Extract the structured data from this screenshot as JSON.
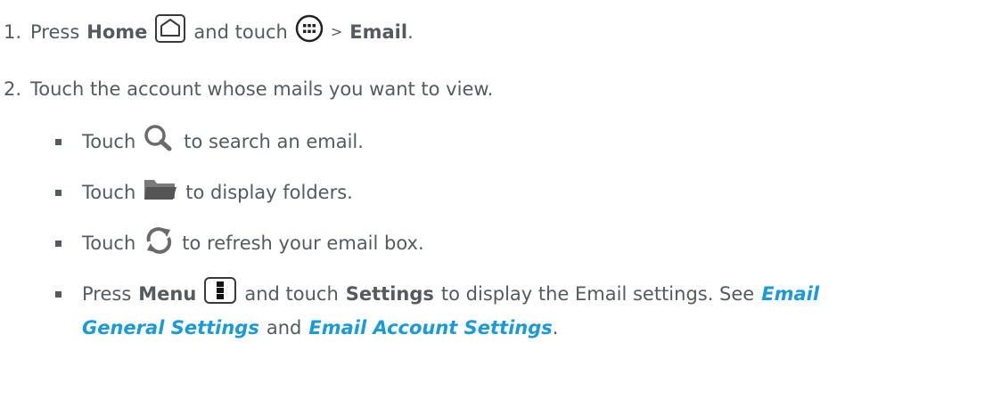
{
  "steps": [
    {
      "number": "1.",
      "text_a": "Press",
      "bold_a": "Home",
      "text_b": "and touch",
      "arrow": ">",
      "bold_b": "Email",
      "end": "."
    },
    {
      "number": "2.",
      "text": "Touch the account whose mails you want to view."
    }
  ],
  "bullets": {
    "search": {
      "text_a": "Touch",
      "text_b": "to search an email."
    },
    "folders": {
      "text_a": "Touch",
      "text_b": "to display folders."
    },
    "refresh": {
      "text_a": "Touch",
      "text_b": "to refresh your email box."
    },
    "menu": {
      "text_a": "Press",
      "bold_a": "Menu",
      "text_b": "and touch",
      "bold_b": "Settings",
      "text_c": "to display the Email settings. See",
      "link_a_line1": "Email",
      "link_a_line2": "General Settings",
      "text_d": "and",
      "link_b": "Email Account Settings",
      "end": "."
    }
  },
  "icons": [
    "home-icon",
    "apps-icon",
    "search-icon",
    "folder-icon",
    "refresh-icon",
    "menu-icon"
  ],
  "colors": {
    "text": "#555a5f",
    "link": "#1b9ad6"
  }
}
